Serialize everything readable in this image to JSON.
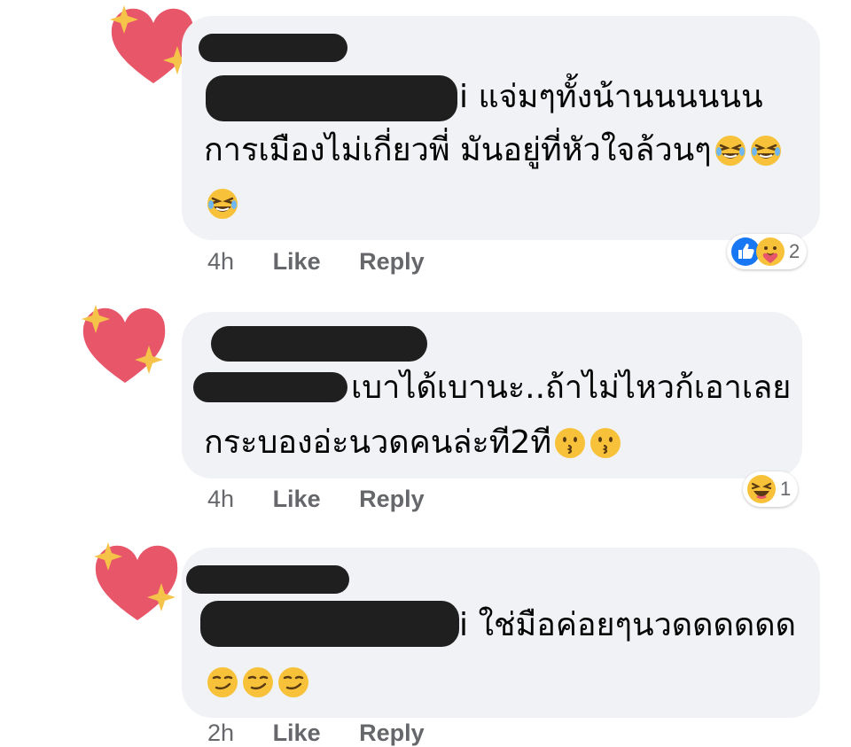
{
  "comments": [
    {
      "author_suffix": "i",
      "lines": [
        "แจ่มๆทั้งน้านนนนนน",
        "การเมืองไม่เกี่ยวพี่ มันอยู่ที่หัวใจล้วนๆ"
      ],
      "time": "4h",
      "like_label": "Like",
      "reply_label": "Reply",
      "reaction_count": "2",
      "reaction_icons": [
        "like-icon",
        "care-icon"
      ],
      "emoji": [
        "rofl-icon",
        "rofl-icon",
        "rofl-icon"
      ]
    },
    {
      "author_suffix": "",
      "lines": [
        "เบาได้เบานะ..ถ้าไม่ไหวก้เอาเลย",
        "กระบองอ่ะนวดคนล่ะที2ที"
      ],
      "time": "4h",
      "like_label": "Like",
      "reply_label": "Reply",
      "reaction_count": "1",
      "reaction_icons": [
        "haha-icon"
      ],
      "emoji": [
        "kissing-face-icon",
        "kissing-face-icon"
      ]
    },
    {
      "author_suffix": "i",
      "lines": [
        "ใช่มือค่อยๆนวดดดดดด"
      ],
      "time": "2h",
      "like_label": "Like",
      "reply_label": "Reply",
      "emoji": [
        "smirk-face-icon",
        "smirk-face-icon",
        "smirk-face-icon"
      ]
    }
  ],
  "colors": {
    "bubble": "#f0f2f5",
    "redaction": "#1f1f1f",
    "meta_text": "#65676b",
    "heart": "#e8566a",
    "sparkle": "#f5c34a"
  }
}
